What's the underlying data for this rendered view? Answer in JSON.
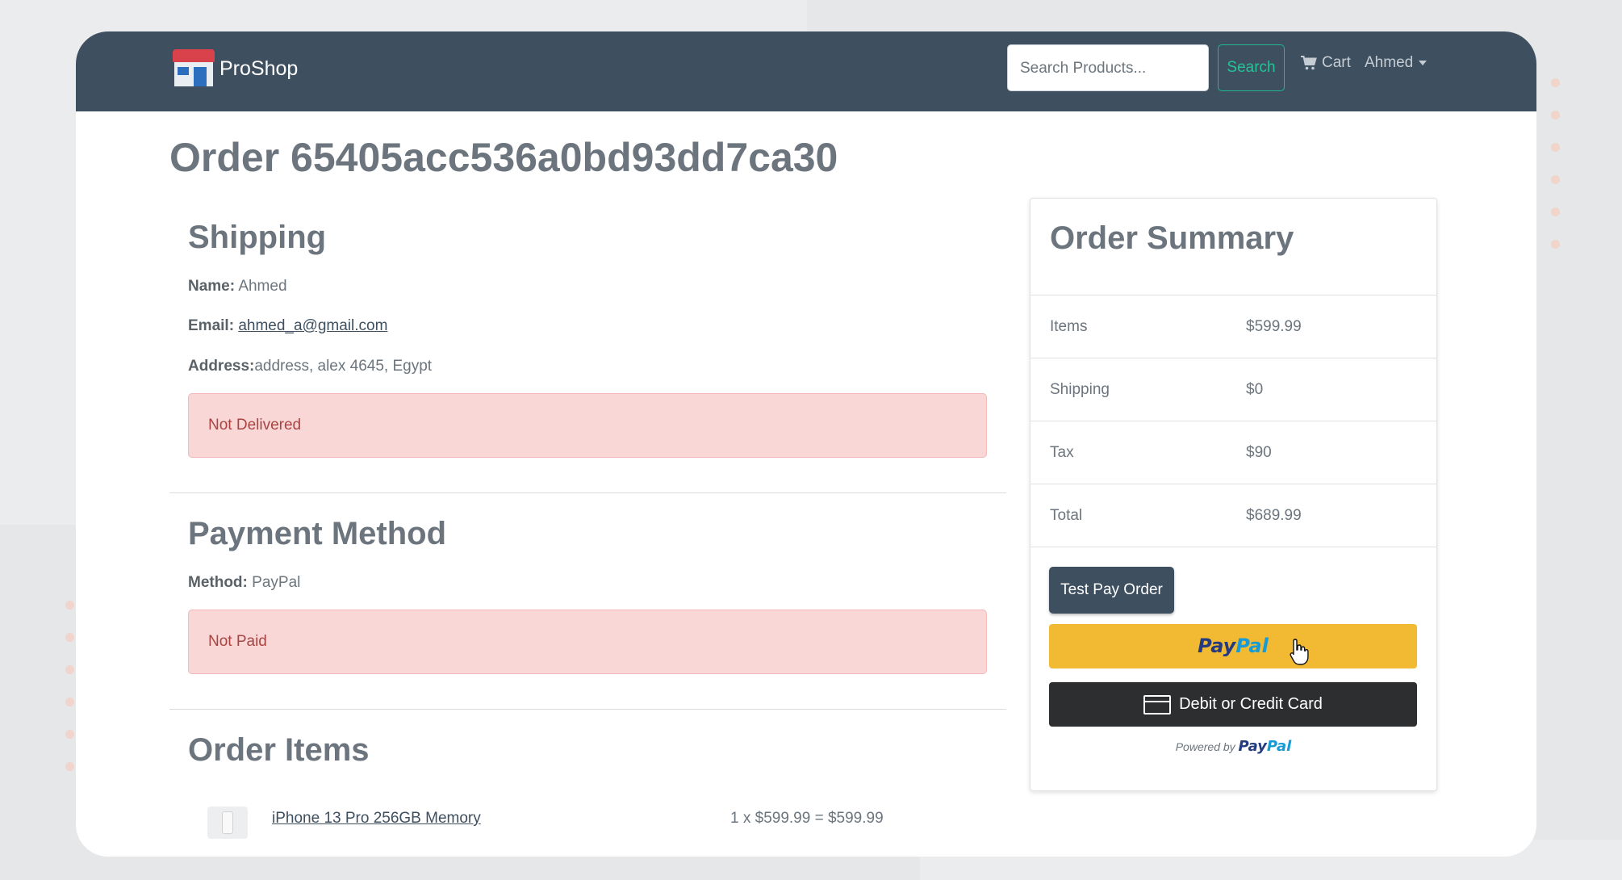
{
  "navbar": {
    "brand": "ProShop",
    "search_placeholder": "Search Products...",
    "search_button": "Search",
    "cart_label": "Cart",
    "user_label": "Ahmed"
  },
  "order": {
    "title": "Order 65405acc536a0bd93dd7ca30"
  },
  "shipping": {
    "heading": "Shipping",
    "name_label": "Name:",
    "name_value": "Ahmed",
    "email_label": "Email:",
    "email_value": "ahmed_a@gmail.com",
    "address_label": "Address:",
    "address_value": "address, alex 4645, Egypt",
    "status": "Not Delivered"
  },
  "payment": {
    "heading": "Payment Method",
    "method_label": "Method:",
    "method_value": "PayPal",
    "status": "Not Paid"
  },
  "order_items": {
    "heading": "Order Items",
    "items": [
      {
        "name": "iPhone 13 Pro 256GB Memory",
        "calc": "1 x $599.99 = $599.99"
      }
    ]
  },
  "summary": {
    "heading": "Order Summary",
    "rows": [
      {
        "label": "Items",
        "value": "$599.99"
      },
      {
        "label": "Shipping",
        "value": "$0"
      },
      {
        "label": "Tax",
        "value": "$90"
      },
      {
        "label": "Total",
        "value": "$689.99"
      }
    ],
    "test_pay_button": "Test Pay Order",
    "paypal_pay": "Pay",
    "paypal_pal": "Pal",
    "card_button": "Debit or Credit Card",
    "powered_by": "Powered by"
  },
  "colors": {
    "navbar": "#3e4f60",
    "accent": "#25c396",
    "alert_bg": "#f8d7d6",
    "paypal_yellow": "#f2b932"
  }
}
